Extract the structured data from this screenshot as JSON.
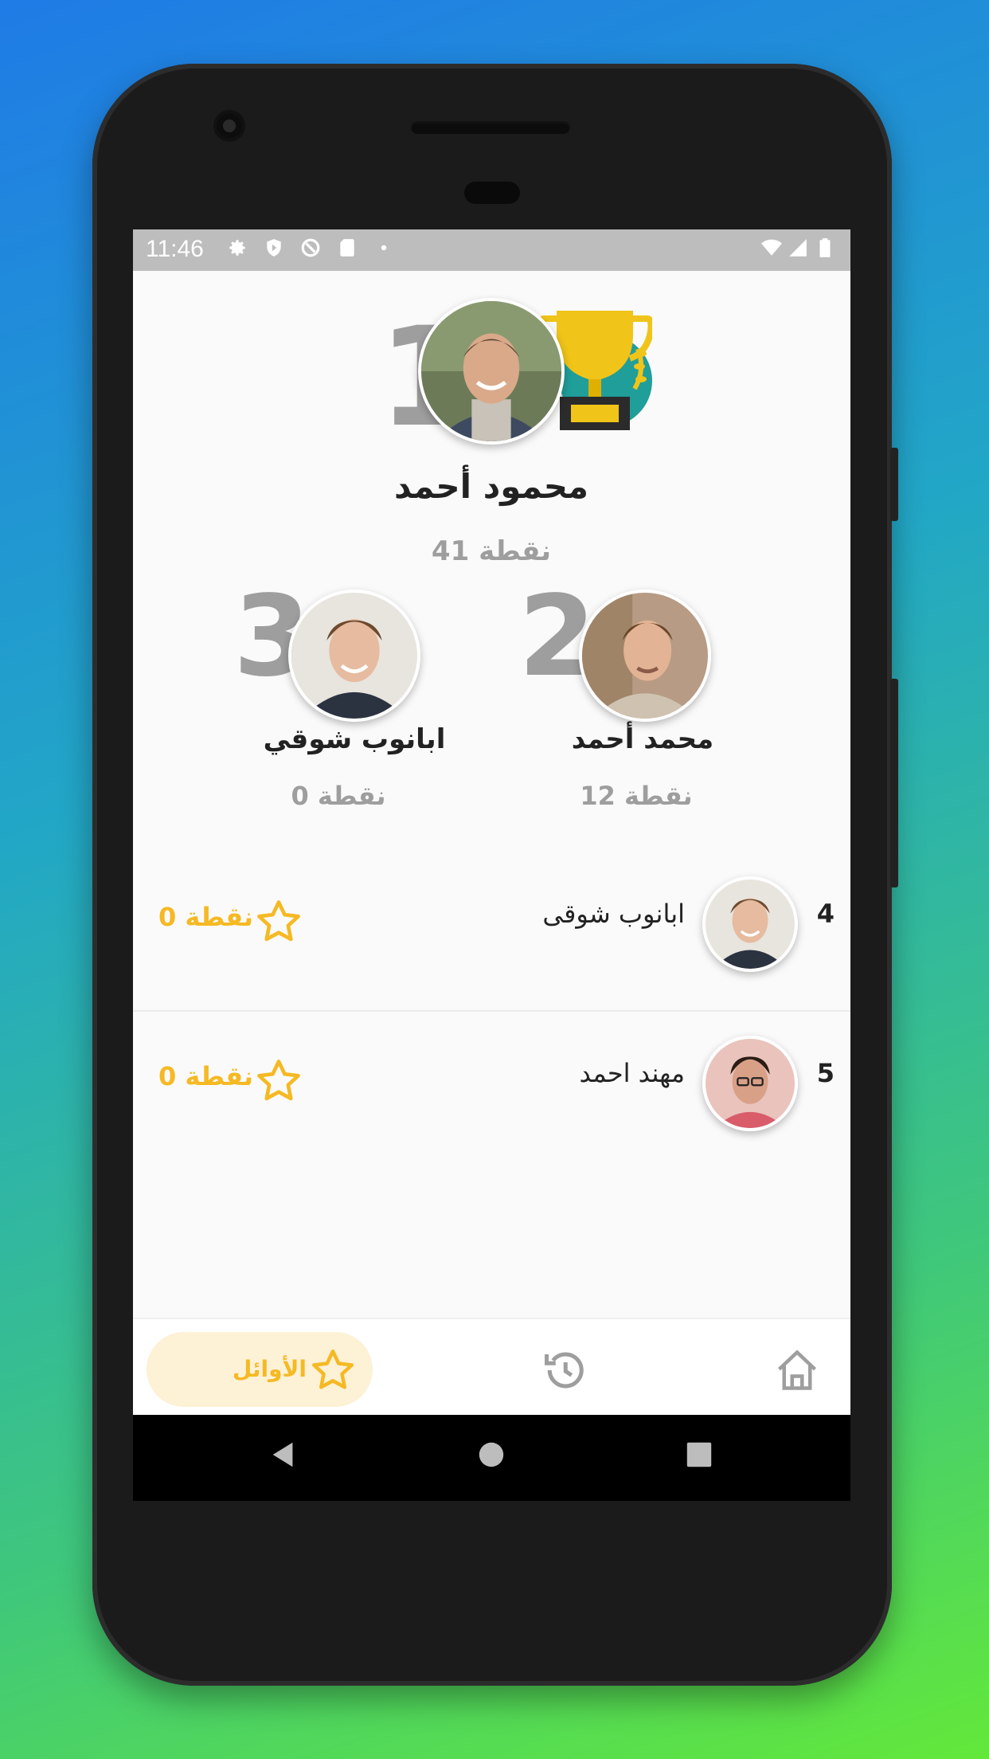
{
  "status_bar": {
    "time": "11:46",
    "left_icons": [
      "gear-icon",
      "shield-icon",
      "data-saver-icon",
      "sd-card-icon",
      "dot-icon"
    ],
    "right_icons": [
      "wifi-icon",
      "signal-icon",
      "battery-icon"
    ]
  },
  "leaderboard": {
    "first": {
      "rank": "1",
      "name": "محمود أحمد",
      "points": "41 نقطة"
    },
    "second": {
      "rank": "2",
      "name": "محمد أحمد",
      "points": "12 نقطة"
    },
    "third": {
      "rank": "3",
      "name": "ابانوب شوقي",
      "points": "0 نقطة"
    },
    "list": [
      {
        "rank": "4",
        "name": "ابانوب شوقى",
        "points": "0 نقطة"
      },
      {
        "rank": "5",
        "name": "مهند احمد",
        "points": "0 نقطة"
      }
    ]
  },
  "bottom_nav": {
    "active_label": "الأوائل",
    "items": [
      "home-icon",
      "history-icon",
      "star-icon"
    ]
  },
  "colors": {
    "accent": "#f5b923",
    "accent_bg": "#fdf1d6",
    "rank_gray": "#9e9e9e",
    "trophy_gold": "#f0c419",
    "trophy_teal": "#1f9e9a"
  }
}
